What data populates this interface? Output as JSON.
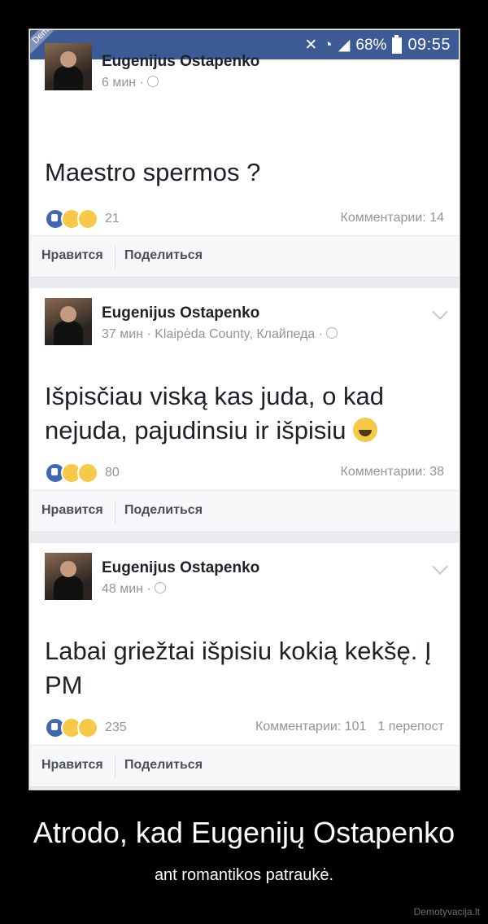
{
  "statusbar": {
    "battery": "68%",
    "time": "09:55"
  },
  "watermark": "Demotyvacija.lt",
  "posts": [
    {
      "author": "Eugenijus Ostapenko",
      "time": "6 мин ·",
      "text": "Maestro spermos ?",
      "reactions": "21",
      "comments": "Комментарии: 14",
      "shares": ""
    },
    {
      "author": "Eugenijus Ostapenko",
      "time": "37 мин · Klaipėda County, Клайпеда ·",
      "text": "Išpisčiau viską kas juda, o kad nejuda, pajudinsiu ir išpisiu",
      "reactions": "80",
      "comments": "Комментарии: 38",
      "shares": ""
    },
    {
      "author": "Eugenijus Ostapenko",
      "time": "48 мин ·",
      "text": "Labai griežtai išpisiu kokią kekšę. Į PM",
      "reactions": "235",
      "comments": "Комментарии: 101",
      "shares": "1 перепост"
    }
  ],
  "actions": {
    "like": "Нравится",
    "share": "Поделиться"
  },
  "caption": {
    "title": "Atrodo, kad Eugenijų Ostapenko",
    "subtitle": "ant romantikos patraukė."
  },
  "site": "Demotyvacija.lt"
}
